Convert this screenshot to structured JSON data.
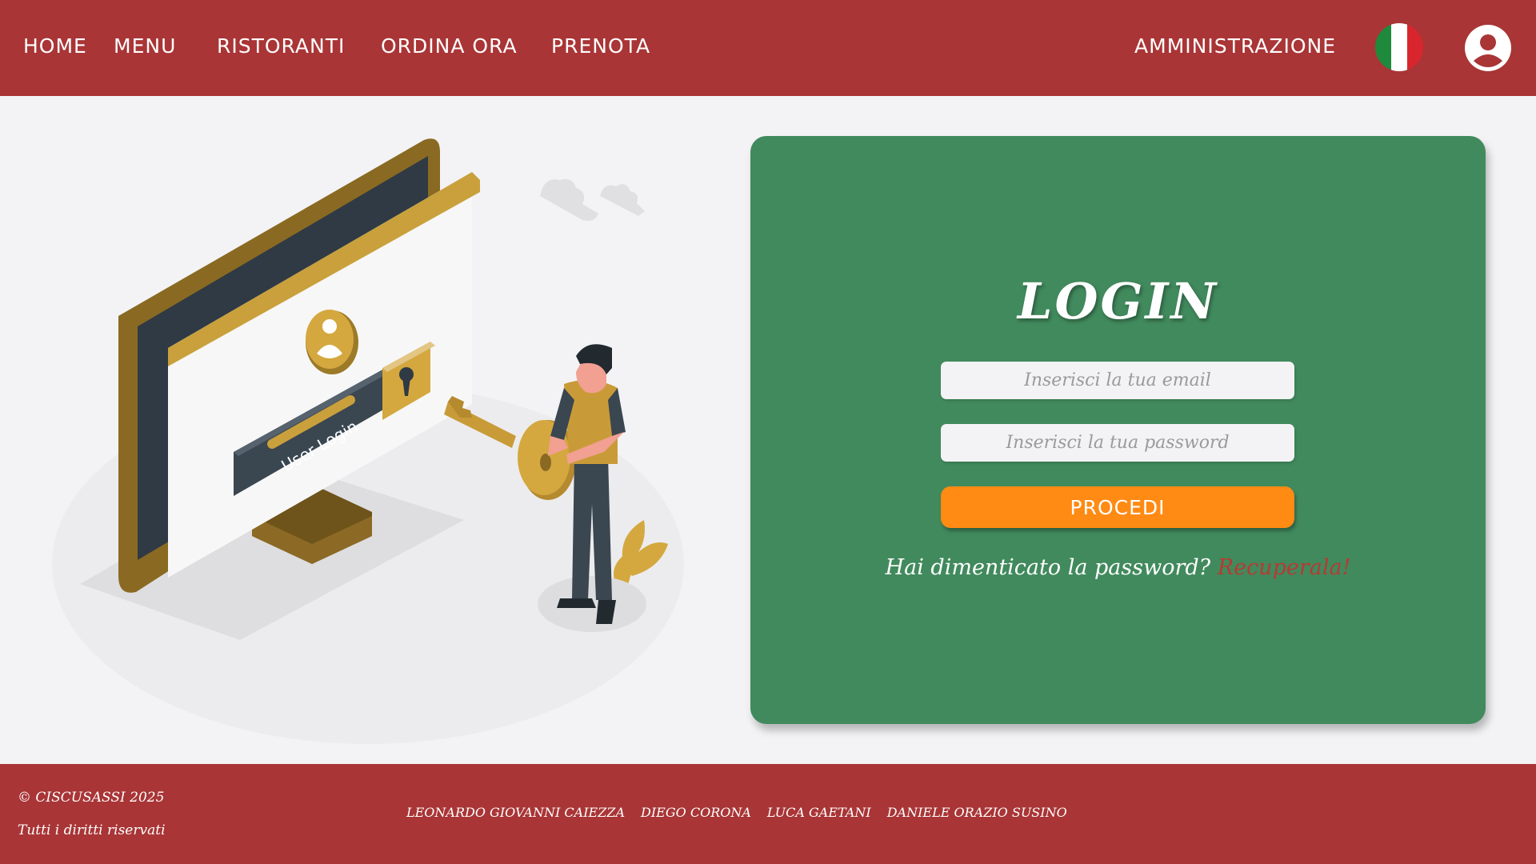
{
  "nav": {
    "home": "HOME",
    "menu": "MENU",
    "ristoranti": "RISTORANTI",
    "ordina": "ORDINA ORA",
    "prenota": "PRENOTA",
    "admin": "AMMINISTRAZIONE",
    "flag_icon": "italy-flag-icon",
    "user_icon": "user-circle-icon"
  },
  "illustration": {
    "screen_label": "User Login"
  },
  "login": {
    "title": "LOGIN",
    "email_placeholder": "Inserisci la tua email",
    "password_placeholder": "Inserisci la tua password",
    "submit_label": "PROCEDI",
    "forgot_text": "Hai dimenticato la password?",
    "recover_link": "Recuperala!"
  },
  "footer": {
    "copyright": "© CISCUSASSI 2025",
    "rights": "Tutti i diritti riservati",
    "authors": [
      "LEONARDO GIOVANNI CAIEZZA",
      "DIEGO CORONA",
      "LUCA GAETANI",
      "DANIELE ORAZIO SUSINO"
    ]
  },
  "colors": {
    "header": "#a93536",
    "card": "#418a5d",
    "button": "#ff8a14",
    "link": "#b73a33",
    "background": "#f3f3f5"
  }
}
